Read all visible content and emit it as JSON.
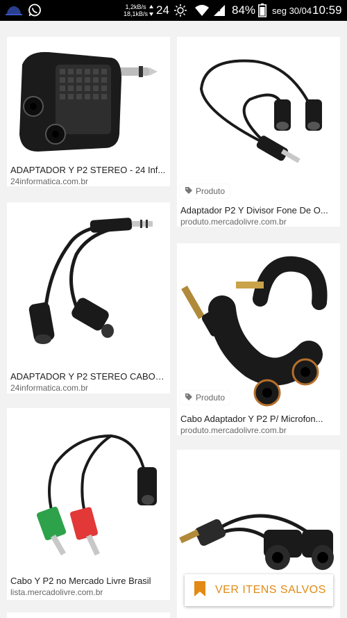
{
  "status_bar": {
    "net_up": "1,2kB/s",
    "net_down": "18,1kB/s",
    "signal_number": "24",
    "battery": "84%",
    "date": "seg 30/04",
    "time": "10:59"
  },
  "results": [
    {
      "title": "ADAPTADOR Y P2 STEREO - 24 Inf...",
      "domain": "24informatica.com.br",
      "badge": ""
    },
    {
      "title": "Adaptador P2 Y Divisor Fone De O...",
      "domain": "produto.mercadolivre.com.br",
      "badge": "Produto"
    },
    {
      "title": "ADAPTADOR Y P2 STEREO CABO -...",
      "domain": "24informatica.com.br",
      "badge": ""
    },
    {
      "title": "Cabo Adaptador Y P2 P/ Microfon...",
      "domain": "produto.mercadolivre.com.br",
      "badge": "Produto"
    },
    {
      "title": "Cabo Y P2 no Mercado Livre Brasil",
      "domain": "lista.mercadolivre.com.br",
      "badge": ""
    }
  ],
  "save_button": {
    "label": "VER ITENS SALVOS",
    "color": "#e28a14"
  },
  "colors": {
    "status_bar": "#000000",
    "page_bg": "#f2f2f2",
    "accent": "#e28a14"
  }
}
